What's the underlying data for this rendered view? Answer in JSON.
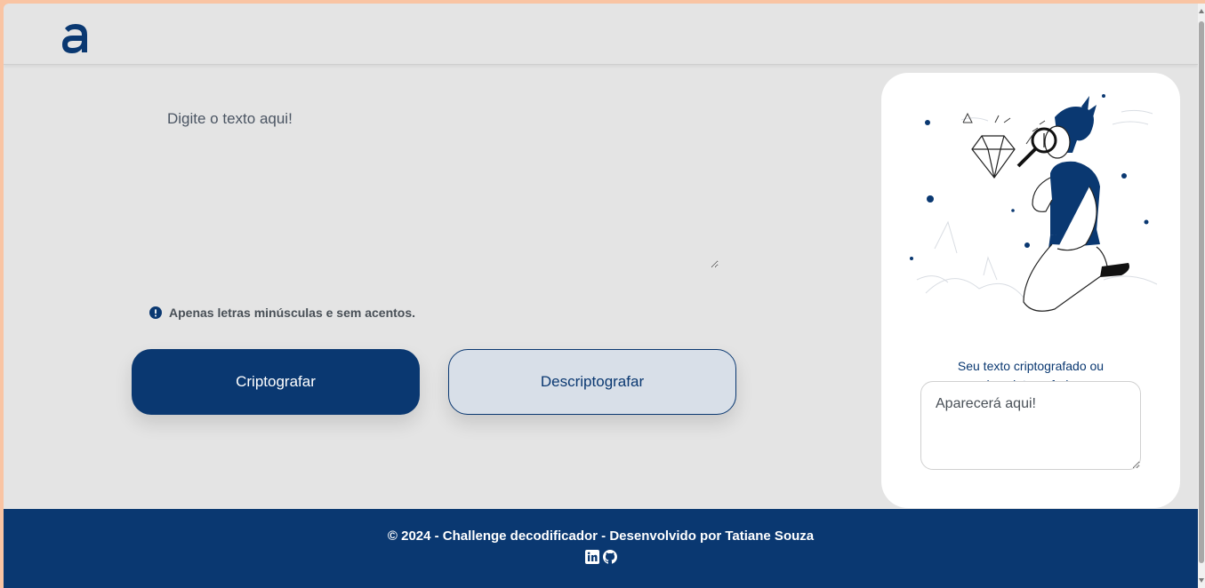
{
  "header": {
    "logo_icon": "alura-logo-icon"
  },
  "main": {
    "input_placeholder": "Digite o texto aqui!",
    "hint_icon": "info-circle-icon",
    "hint_text": "Apenas letras minúsculas e sem acentos.",
    "encrypt_label": "Criptografar",
    "decrypt_label": "Descriptografar"
  },
  "result": {
    "illustration": "boy-with-magnifier-illustration",
    "message": "Seu texto criptografado ou descriptografado.",
    "output_placeholder": "Aparecerá aqui!"
  },
  "footer": {
    "text": "© 2024 - Challenge decodificador - Desenvolvido por Tatiane Souza",
    "icons": [
      "linkedin-icon",
      "github-icon"
    ]
  },
  "colors": {
    "primary": "#0a3871",
    "background": "#e4e4e4",
    "secondary_button_bg": "#d8dfe8",
    "page_border": "#f9c4a3"
  }
}
